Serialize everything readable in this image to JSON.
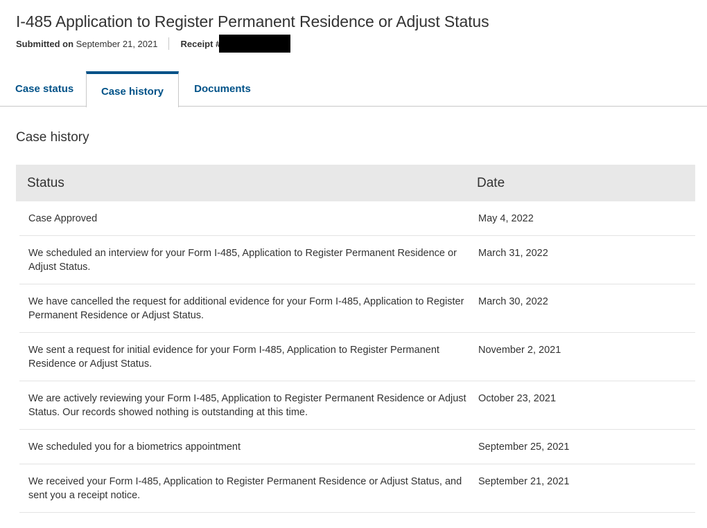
{
  "header": {
    "title": "I-485 Application to Register Permanent Residence or Adjust Status",
    "submitted_label": "Submitted on",
    "submitted_date": "September 21, 2021",
    "receipt_label": "Receipt #"
  },
  "tabs": [
    {
      "label": "Case status",
      "active": false
    },
    {
      "label": "Case history",
      "active": true
    },
    {
      "label": "Documents",
      "active": false
    }
  ],
  "section": {
    "title": "Case history"
  },
  "table": {
    "columns": [
      "Status",
      "Date"
    ],
    "rows": [
      {
        "status": "Case Approved",
        "date": "May 4, 2022"
      },
      {
        "status": "We scheduled an interview for your Form I-485, Application to Register Permanent Residence or Adjust Status.",
        "date": "March 31, 2022"
      },
      {
        "status": "We have cancelled the request for additional evidence for your Form I-485, Application to Register Permanent Residence or Adjust Status.",
        "date": "March 30, 2022"
      },
      {
        "status": "We sent a request for initial evidence for your Form I-485, Application to Register Permanent Residence or Adjust Status.",
        "date": "November 2, 2021"
      },
      {
        "status": "We are actively reviewing your Form I-485, Application to Register Permanent Residence or Adjust Status. Our records showed nothing is outstanding at this time.",
        "date": "October 23, 2021"
      },
      {
        "status": "We scheduled you for a biometrics appointment",
        "date": "September 25, 2021"
      },
      {
        "status": "We received your Form I-485, Application to Register Permanent Residence or Adjust Status, and sent you a receipt notice.",
        "date": "September 21, 2021"
      }
    ]
  },
  "colors": {
    "link": "#005288",
    "header_bg": "#e8e8e8",
    "text": "#333333"
  }
}
